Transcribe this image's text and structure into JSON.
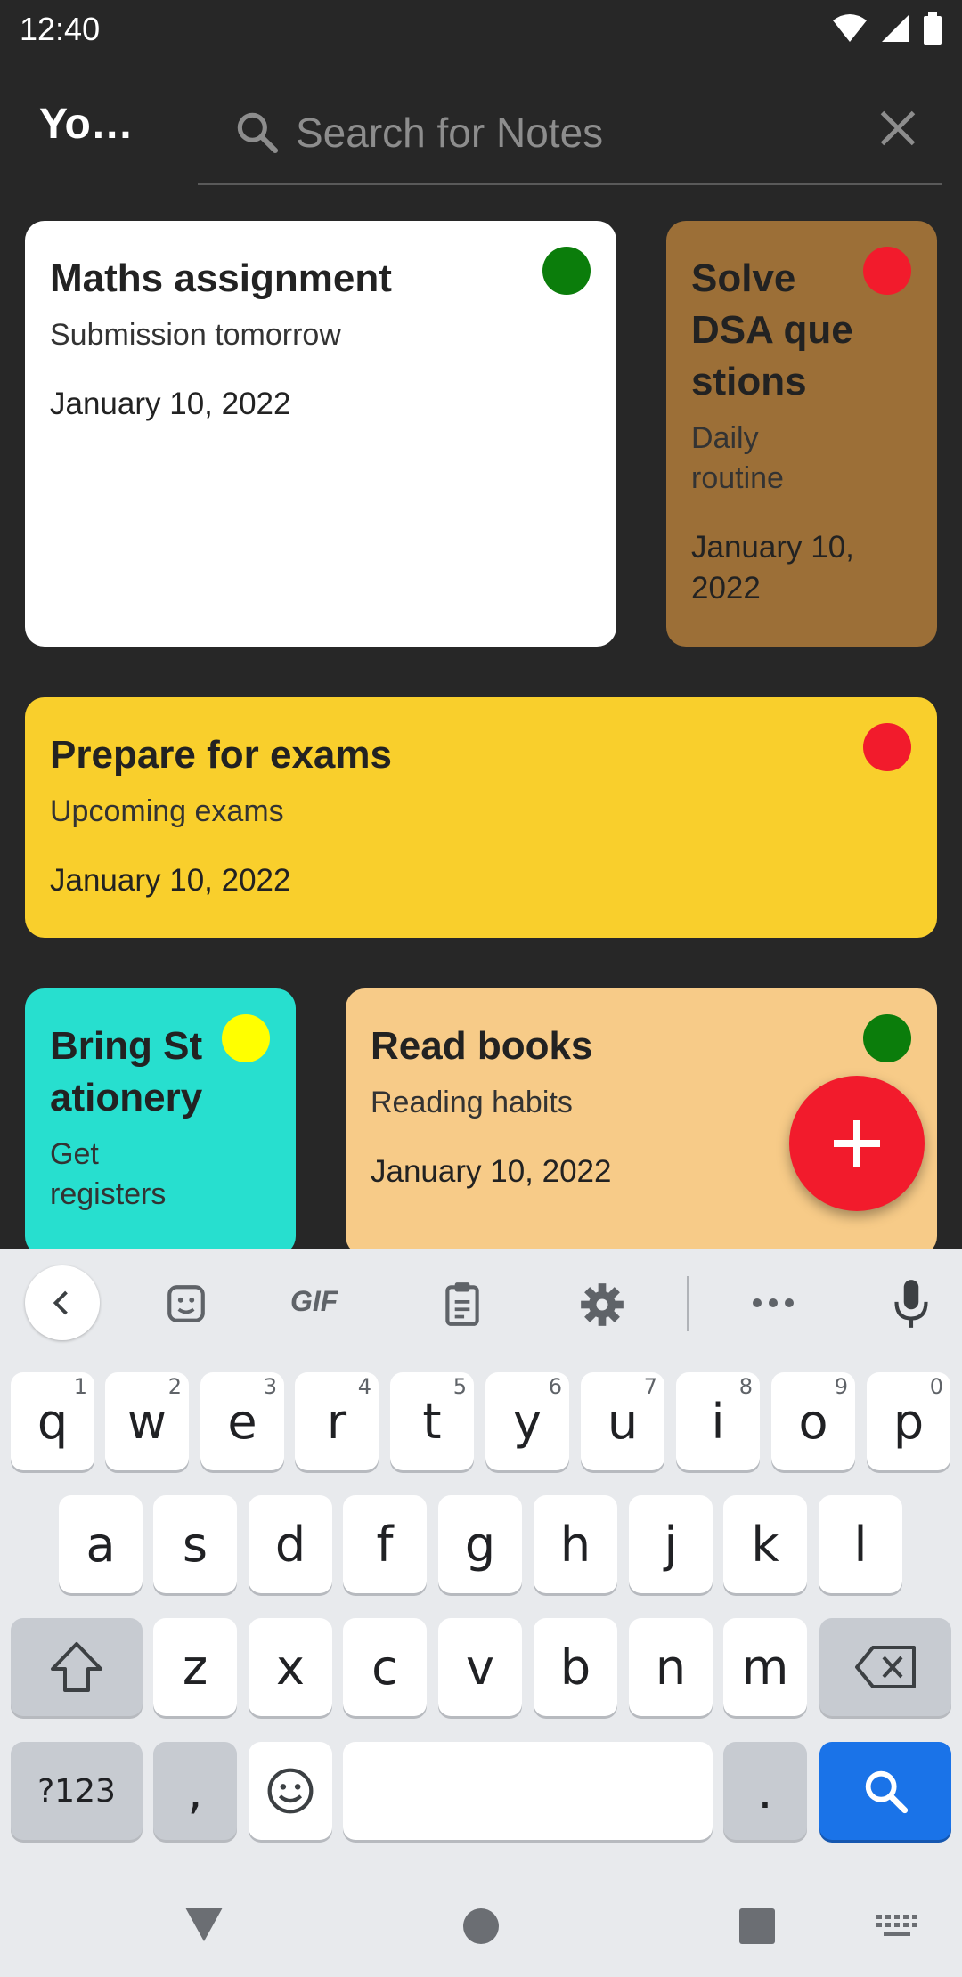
{
  "status_bar": {
    "time": "12:40",
    "icons": [
      "wifi-icon",
      "signal-icon",
      "battery-icon"
    ]
  },
  "toolbar": {
    "title": "Yo…",
    "search_placeholder": "Search for Notes",
    "search_value": ""
  },
  "notes": [
    {
      "title": "Maths assignment",
      "subtitle": "Submission tomorrow",
      "date": "January 10, 2022",
      "card_color": "#ffffff",
      "priority_color": "#0b7d0b"
    },
    {
      "title": "Solve DSA que stions",
      "subtitle": "Daily routine",
      "date": "January 10, 2022",
      "card_color": "#9c6f37",
      "priority_color": "#f21b2c"
    },
    {
      "title": "Prepare for exams",
      "subtitle": "Upcoming exams",
      "date": "January 10, 2022",
      "card_color": "#f9cf2c",
      "priority_color": "#f21b2c"
    },
    {
      "title": "Bring St ationery",
      "subtitle": "Get registers",
      "date": "",
      "card_color": "#27dfcf",
      "priority_color": "#ffff00"
    },
    {
      "title": "Read books",
      "subtitle": "Reading habits",
      "date": "January 10, 2022",
      "card_color": "#f7cb88",
      "priority_color": "#0b7d0b"
    }
  ],
  "fab": {
    "icon": "plus-icon",
    "color": "#f21b2c"
  },
  "keyboard": {
    "toolbar_icons": [
      "back-chevron-icon",
      "sticker-icon",
      "gif-icon",
      "clipboard-icon",
      "settings-icon",
      "more-icon",
      "microphone-icon"
    ],
    "gif_label": "GIF",
    "row1": [
      {
        "label": "q",
        "hint": "1"
      },
      {
        "label": "w",
        "hint": "2"
      },
      {
        "label": "e",
        "hint": "3"
      },
      {
        "label": "r",
        "hint": "4"
      },
      {
        "label": "t",
        "hint": "5"
      },
      {
        "label": "y",
        "hint": "6"
      },
      {
        "label": "u",
        "hint": "7"
      },
      {
        "label": "i",
        "hint": "8"
      },
      {
        "label": "o",
        "hint": "9"
      },
      {
        "label": "p",
        "hint": "0"
      }
    ],
    "row2": [
      "a",
      "s",
      "d",
      "f",
      "g",
      "h",
      "j",
      "k",
      "l"
    ],
    "row3": [
      "z",
      "x",
      "c",
      "v",
      "b",
      "n",
      "m"
    ],
    "symbols_label": "?123",
    "comma_label": ",",
    "period_label": ".",
    "action_color": "#1a73e8"
  }
}
